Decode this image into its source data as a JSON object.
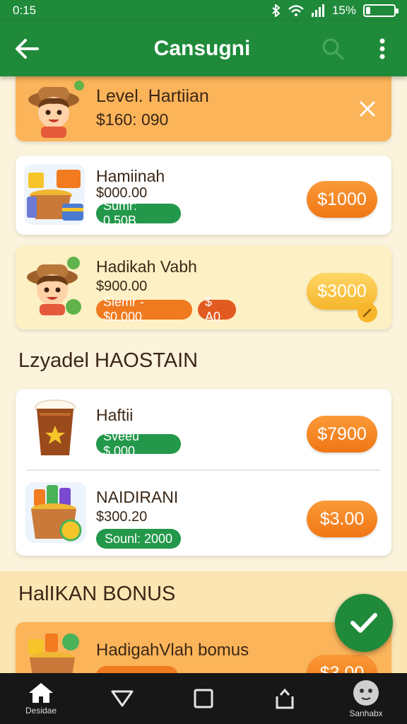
{
  "status": {
    "time": "0:15",
    "battery_text": "15%",
    "battery_level": 0.15
  },
  "appbar": {
    "title": "Cansugni",
    "back_icon": "back-arrow-icon",
    "search_icon": "search-icon",
    "more_icon": "more-vertical-icon"
  },
  "banner": {
    "title": "Level. Hartiian",
    "amount": "$160: 090",
    "close_icon": "close-icon"
  },
  "items": [
    {
      "name": "Hamiinah",
      "amount": "$000.00",
      "pill": "Sumr: 0.50B",
      "price": "$1000"
    },
    {
      "name": "Hadikah Vabh",
      "amount": "$900.00",
      "pill": "Slemr - $0.000",
      "pill2": "$ A0",
      "price": "$3000"
    }
  ],
  "section1": {
    "title": "Lzyadel HAOSTAIN"
  },
  "section1_items": [
    {
      "name": "Haftii",
      "pill": "Sveeu $.000",
      "price": "$7900"
    },
    {
      "name": "NAIDIRANI",
      "amount": "$300.20",
      "pill": "Sounl: 2000",
      "price": "$3.00"
    }
  ],
  "section2": {
    "title": "HalIKAN BONUS"
  },
  "bonus_item": {
    "name": "HadigahVlah bomus",
    "price": "$3.00"
  },
  "nav": {
    "home_label": "Desidae",
    "profile_label": "Sanhabx"
  },
  "colors": {
    "primary_green": "#1f8a3a",
    "accent_orange": "#f07a1f",
    "price_yellow": "#f6b52b",
    "background": "#fbf3dc"
  }
}
